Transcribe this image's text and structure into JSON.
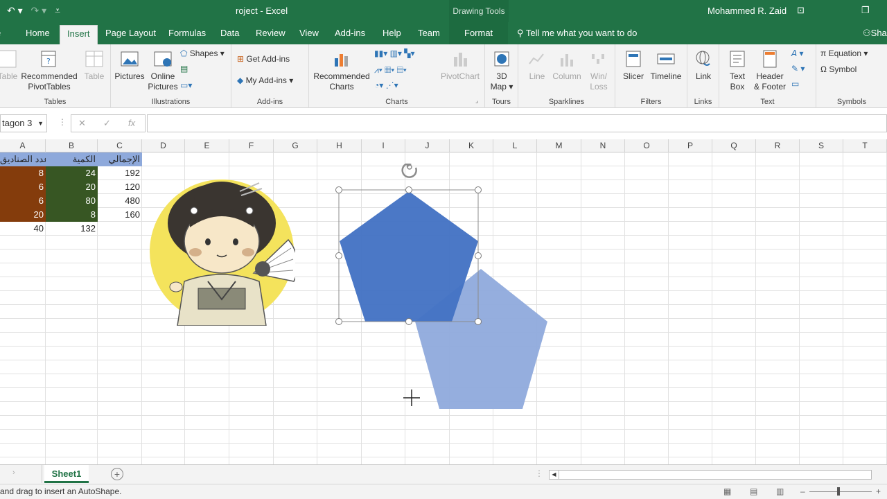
{
  "titlebar": {
    "doc_title": "roject  -  Excel",
    "drawing_tools": "Drawing Tools",
    "user": "Mohammed R. Zaid"
  },
  "tabs": {
    "home": "Home",
    "insert": "Insert",
    "page_layout": "Page Layout",
    "formulas": "Formulas",
    "data": "Data",
    "review": "Review",
    "view": "View",
    "addins": "Add-ins",
    "help": "Help",
    "team": "Team",
    "format": "Format",
    "tellme": "Tell me what you want to do",
    "share": "Sha"
  },
  "ribbon": {
    "tables": {
      "label": "Tables",
      "table_partial": "Table",
      "recommended_pivot_1": "Recommended",
      "recommended_pivot_2": "PivotTables",
      "table": "Table"
    },
    "illustrations": {
      "label": "Illustrations",
      "pictures": "Pictures",
      "online_pictures_1": "Online",
      "online_pictures_2": "Pictures",
      "shapes": "Shapes"
    },
    "addins": {
      "label": "Add-ins",
      "get_addins": "Get Add-ins",
      "my_addins": "My Add-ins"
    },
    "charts": {
      "label": "Charts",
      "recommended_charts_1": "Recommended",
      "recommended_charts_2": "Charts",
      "pivotchart": "PivotChart"
    },
    "tours": {
      "label": "Tours",
      "map_1": "3D",
      "map_2": "Map"
    },
    "sparklines": {
      "label": "Sparklines",
      "line": "Line",
      "column": "Column",
      "winloss_1": "Win/",
      "winloss_2": "Loss"
    },
    "filters": {
      "label": "Filters",
      "slicer": "Slicer",
      "timeline": "Timeline"
    },
    "links": {
      "label": "Links",
      "link": "Link"
    },
    "text": {
      "label": "Text",
      "textbox_1": "Text",
      "textbox_2": "Box",
      "header_1": "Header",
      "header_2": "& Footer"
    },
    "symbols": {
      "label": "Symbols",
      "equation": "Equation",
      "symbol": "Symbol"
    }
  },
  "formula_bar": {
    "name_box": "tagon 3",
    "cancel": "✕",
    "enter": "✓",
    "fx": "fx",
    "value": ""
  },
  "columns": [
    "A",
    "B",
    "C",
    "D",
    "E",
    "F",
    "G",
    "H",
    "I",
    "J",
    "K",
    "L",
    "M",
    "N",
    "O",
    "P",
    "Q",
    "R",
    "S",
    "T"
  ],
  "table": {
    "headers": [
      "عدد الصناديق",
      "الكمية",
      "الإجمالي"
    ],
    "rows": [
      [
        "8",
        "24",
        "192"
      ],
      [
        "6",
        "20",
        "120"
      ],
      [
        "6",
        "80",
        "480"
      ],
      [
        "20",
        "8",
        "160"
      ]
    ],
    "totals": [
      "40",
      "132"
    ]
  },
  "sheet_tabs": [
    "Sheet1"
  ],
  "status": {
    "message": "and drag to insert an AutoShape."
  },
  "colors": {
    "excel_green": "#217346",
    "header_blue": "#8ea9db",
    "col_a_fill": "#843c0c",
    "col_b_fill": "#375623",
    "pentagon_dark": "#4472c4",
    "pentagon_light": "#8faadc",
    "circle_yellow": "#f4e35c"
  }
}
